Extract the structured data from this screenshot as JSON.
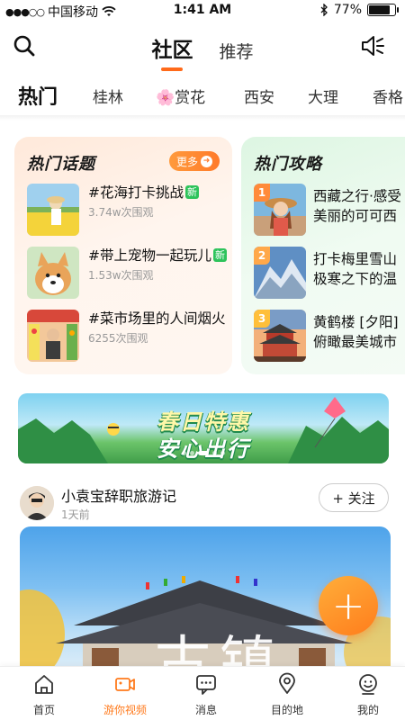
{
  "status_bar": {
    "carrier": "中国移动",
    "time": "1:41 AM",
    "battery": "77%",
    "battery_level": 0.77
  },
  "header": {
    "tabs": [
      {
        "label": "社区",
        "active": true
      },
      {
        "label": "推荐",
        "active": false
      }
    ],
    "search_icon": "search-icon",
    "volume_icon": "volume-icon"
  },
  "categories": [
    {
      "label": "热门",
      "active": true
    },
    {
      "label": "桂林"
    },
    {
      "label": "🌸赏花"
    },
    {
      "label": "西安"
    },
    {
      "label": "大理"
    },
    {
      "label": "香格"
    }
  ],
  "hot_topics": {
    "title": "热门话题",
    "more_label": "更多",
    "items": [
      {
        "title": "#花海打卡挑战",
        "badge": "新",
        "views": "3.74w次围观"
      },
      {
        "title": "#带上宠物一起玩儿",
        "badge": "新",
        "views": "1.53w次围观"
      },
      {
        "title": "#菜市场里的人间烟火",
        "badge": "",
        "views": "6255次围观"
      }
    ]
  },
  "hot_guides": {
    "title": "热门攻略",
    "items": [
      {
        "rank": "1",
        "line1": "西藏之行·感受",
        "line2": "美丽的可可西"
      },
      {
        "rank": "2",
        "line1": "打卡梅里雪山",
        "line2": "极寒之下的温"
      },
      {
        "rank": "3",
        "line1": "黄鹤楼 [夕阳]",
        "line2": "俯瞰最美城市"
      }
    ]
  },
  "banner": {
    "line1": "春日特惠",
    "line2": "安心出行",
    "active_dot": 2
  },
  "post": {
    "author": "小袁宝辞职旅游记",
    "time": "1天前",
    "follow_label": "+ 关注",
    "overlay_text": "古镇"
  },
  "fab": {
    "label": "+"
  },
  "bottom_nav": [
    {
      "label": "首页",
      "icon": "home-icon"
    },
    {
      "label": "游你视频",
      "icon": "video-camera-icon",
      "active": true
    },
    {
      "label": "消息",
      "icon": "message-icon"
    },
    {
      "label": "目的地",
      "icon": "location-pin-icon"
    },
    {
      "label": "我的",
      "icon": "profile-icon"
    }
  ],
  "colors": {
    "accent": "#ff7a1c",
    "new_badge": "#2ec35b",
    "rank1": "#ff8a3a",
    "rank2": "#ffa84a",
    "rank3": "#ffbf3a"
  }
}
